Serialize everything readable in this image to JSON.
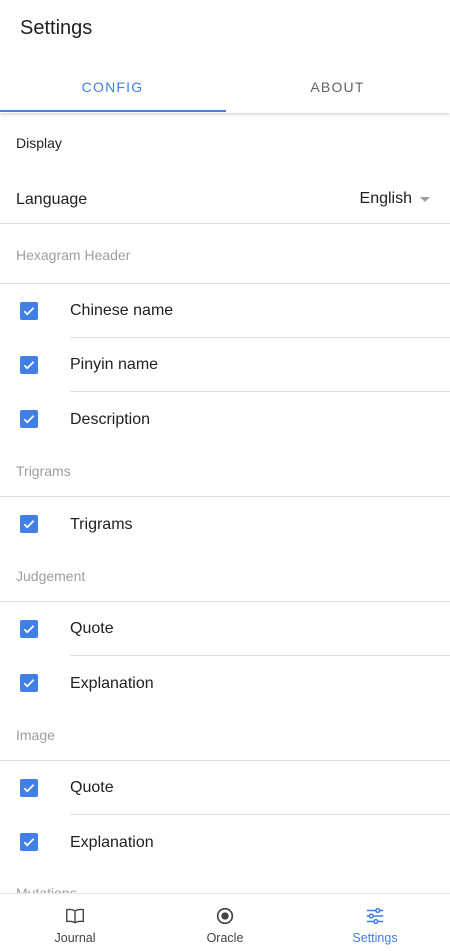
{
  "header": {
    "title": "Settings"
  },
  "tabs": [
    {
      "label": "CONFIG",
      "active": true
    },
    {
      "label": "ABOUT",
      "active": false
    }
  ],
  "display": {
    "section_label": "Display",
    "language_label": "Language",
    "language_value": "English"
  },
  "sections": {
    "hexagram": {
      "title": "Hexagram Header",
      "items": [
        "Chinese name",
        "Pinyin name",
        "Description"
      ]
    },
    "trigrams": {
      "title": "Trigrams",
      "items": [
        "Trigrams"
      ]
    },
    "judgement": {
      "title": "Judgement",
      "items": [
        "Quote",
        "Explanation"
      ]
    },
    "image": {
      "title": "Image",
      "items": [
        "Quote",
        "Explanation"
      ]
    },
    "mutations": {
      "title": "Mutations"
    }
  },
  "bottom_nav": [
    {
      "label": "Journal",
      "icon": "book-icon",
      "active": false
    },
    {
      "label": "Oracle",
      "icon": "record-icon",
      "active": false
    },
    {
      "label": "Settings",
      "icon": "tune-icon",
      "active": true
    }
  ],
  "colors": {
    "accent": "#3f7fe6",
    "muted": "#9e9e9e",
    "divider": "#e0e0e0"
  }
}
